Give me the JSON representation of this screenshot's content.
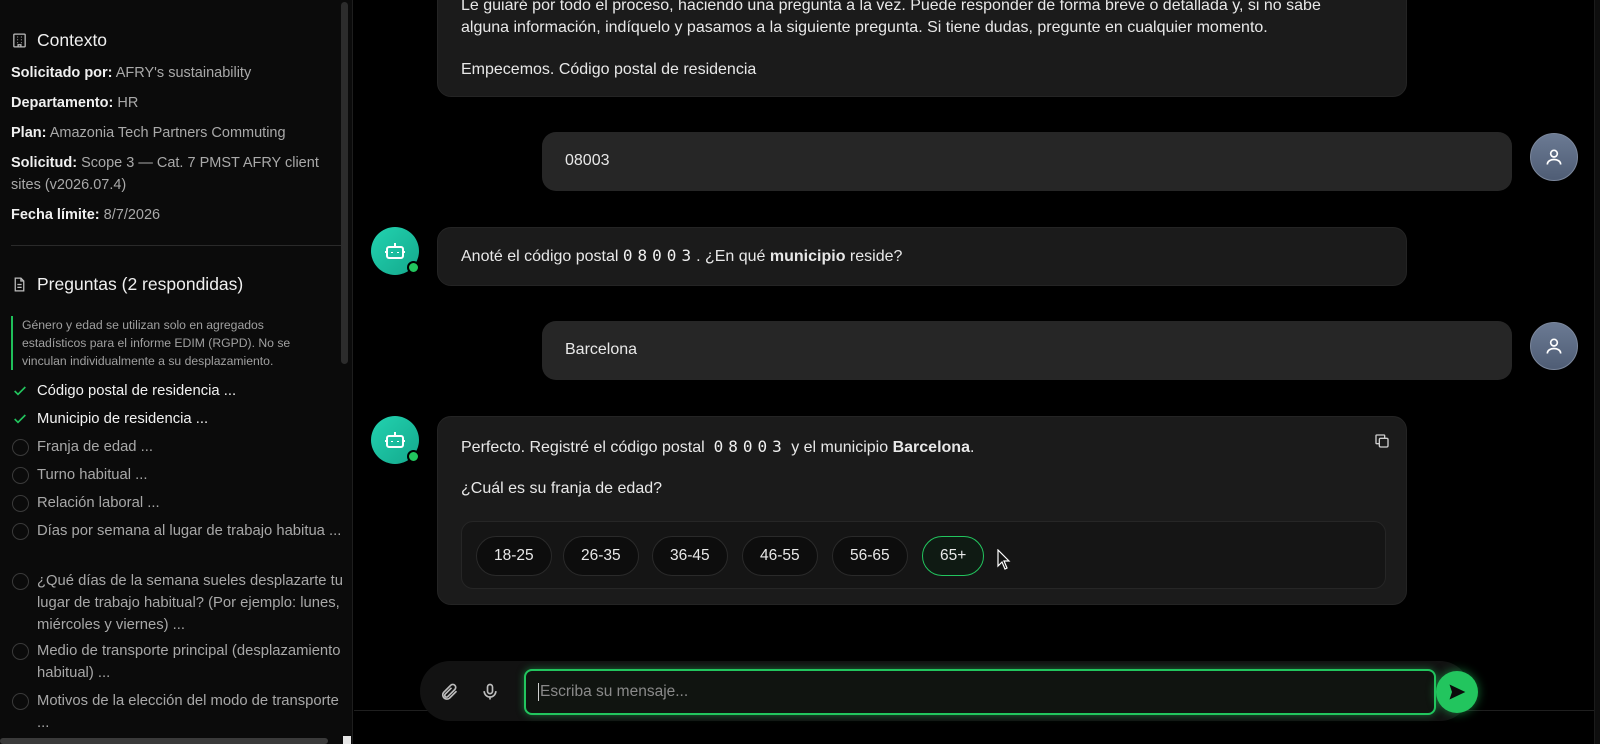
{
  "sidebar": {
    "context": {
      "title": "Contexto",
      "fields": [
        {
          "label": "Solicitado por:",
          "value": "AFRY's sustainability"
        },
        {
          "label": "Departamento:",
          "value": "HR"
        },
        {
          "label": "Plan:",
          "value": "Amazonia Tech Partners Commuting"
        },
        {
          "label": "Solicitud:",
          "value": "Scope 3 — Cat. 7 PMST AFRY client sites (v2026.07.4)"
        },
        {
          "label": "Fecha límite:",
          "value": "8/7/2026"
        }
      ]
    },
    "questions": {
      "title": "Preguntas (2 respondidas)",
      "note": "Género y edad se utilizan solo en agregados estadísticos para el informe EDIM (RGPD). No se vinculan individualmente a su desplazamiento.",
      "items": [
        {
          "label": "Código postal de residencia ...",
          "done": true
        },
        {
          "label": "Municipio de residencia ...",
          "done": true
        },
        {
          "label": "Franja de edad ...",
          "done": false
        },
        {
          "label": "Turno habitual ...",
          "done": false
        },
        {
          "label": "Relación laboral ...",
          "done": false
        },
        {
          "label": "Días por semana al lugar de trabajo habitua ...",
          "done": false
        },
        {
          "label": "¿Qué días de la semana sueles desplazarte tu lugar de trabajo habitual? (Por ejemplo: lunes, miércoles y viernes) ...",
          "done": false
        },
        {
          "label": "Medio de transporte principal (desplazamiento habitual) ...",
          "done": false
        },
        {
          "label": "Motivos de la elección del modo de transporte ...",
          "done": false
        }
      ]
    }
  },
  "chat": {
    "intro": {
      "line1": "Le guiaré por todo el proceso, haciendo una pregunta a la vez. Puede responder de forma breve o detallada y, si no sabe",
      "line2": "alguna información, indíquelo y pasamos a la siguiente pregunta. Si tiene dudas, pregunte en cualquier momento.",
      "line3": "Empecemos. Código postal de residencia"
    },
    "user1": "08003",
    "bot1": {
      "pre": "Anoté el código postal",
      "code": "08003",
      "mid": ". ¿En qué",
      "bold": "municipio",
      "post": "reside?"
    },
    "user2": "Barcelona",
    "bot2": {
      "pre": "Perfecto. Registré el código postal",
      "code": "08003",
      "mid": "y el municipio",
      "bold": "Barcelona",
      "post": ".",
      "question": "¿Cuál es su franja de edad?",
      "options": [
        "18-25",
        "26-35",
        "36-45",
        "46-55",
        "56-65",
        "65+"
      ],
      "selected": "65+"
    }
  },
  "composer": {
    "placeholder": "Escriba su mensaje..."
  },
  "colors": {
    "accent": "#22c55e",
    "bot_avatar": "#1cc4a4",
    "user_avatar": "#5b6880"
  }
}
